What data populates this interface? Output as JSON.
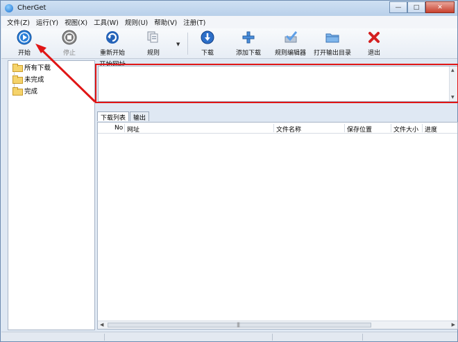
{
  "window": {
    "title": "CherGet"
  },
  "menu": [
    "文件(Z)",
    "运行(Y)",
    "视图(X)",
    "工具(W)",
    "规则(U)",
    "帮助(V)",
    "注册(T)"
  ],
  "toolbar": {
    "start": "开始",
    "stop": "停止",
    "restart": "重新开始",
    "rules": "规则",
    "download": "下载",
    "add_download": "添加下载",
    "rule_editor": "规则编辑器",
    "open_output_dir": "打开输出目录",
    "exit": "退出"
  },
  "tree": [
    "所有下载",
    "未完成",
    "完成"
  ],
  "url_area": {
    "label": "开始网址",
    "value": ""
  },
  "tabs": [
    "下载列表",
    "输出"
  ],
  "list": {
    "columns": [
      "No",
      "网址",
      "文件名称",
      "保存位置",
      "文件大小",
      "进度"
    ],
    "rows": []
  },
  "colors": {
    "annotation": "#e01515",
    "accent": "#1a6fd0"
  }
}
